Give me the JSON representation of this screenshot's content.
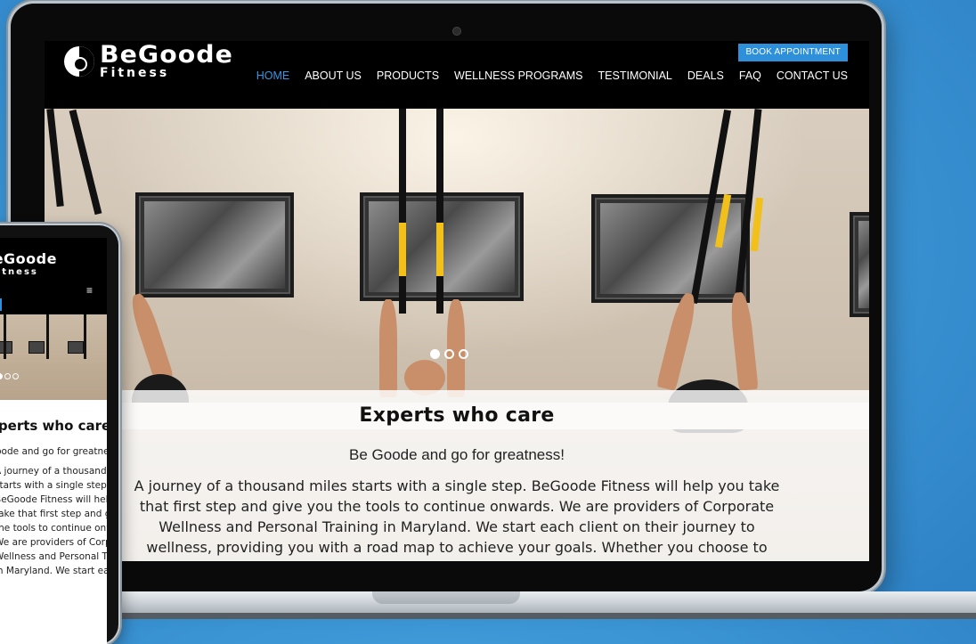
{
  "desktop": {
    "logo": {
      "line1": "BeGoode",
      "line2": "Fitness"
    },
    "book_button": "BOOK APPOINTMENT",
    "nav": [
      {
        "label": "HOME",
        "active": true
      },
      {
        "label": "ABOUT US"
      },
      {
        "label": "PRODUCTS"
      },
      {
        "label": "WELLNESS PROGRAMS"
      },
      {
        "label": "TESTIMONIAL"
      },
      {
        "label": "DEALS"
      },
      {
        "label": "FAQ"
      },
      {
        "label": "CONTACT US"
      }
    ],
    "hero": {
      "slide_count": 3,
      "active_slide": 1,
      "title": "Experts who care",
      "subtitle": "Be Goode and go for greatness!",
      "body_lines": [
        "A journey of a thousand miles starts with a single step. BeGoode Fitness will help you take",
        "that first step and give you the tools to continue onwards. We are providers of Corporate",
        "Wellness and Personal Training in Maryland. We start each client on their journey to",
        "wellness, providing you with a road map to achieve your goals. Whether you choose to"
      ]
    }
  },
  "mobile": {
    "logo": {
      "line1": "BeGoode",
      "line2": "Fitness"
    },
    "menu_icon": "hamburger-icon",
    "title": "Experts who care",
    "subtitle": "Be Goode and go for greatness!",
    "body_lines": [
      "A journey of a thousand miles",
      "starts with a single step.",
      "BeGoode Fitness will help you",
      "take that first step and give you",
      "the tools to continue onwards.",
      "We are providers of Corporate",
      "Wellness and Personal Training",
      "in Maryland. We start each client"
    ]
  },
  "colors": {
    "accent": "#2e8fdb",
    "nav_active": "#3a96e0",
    "background": "#3d97d6",
    "header": "#000000"
  }
}
